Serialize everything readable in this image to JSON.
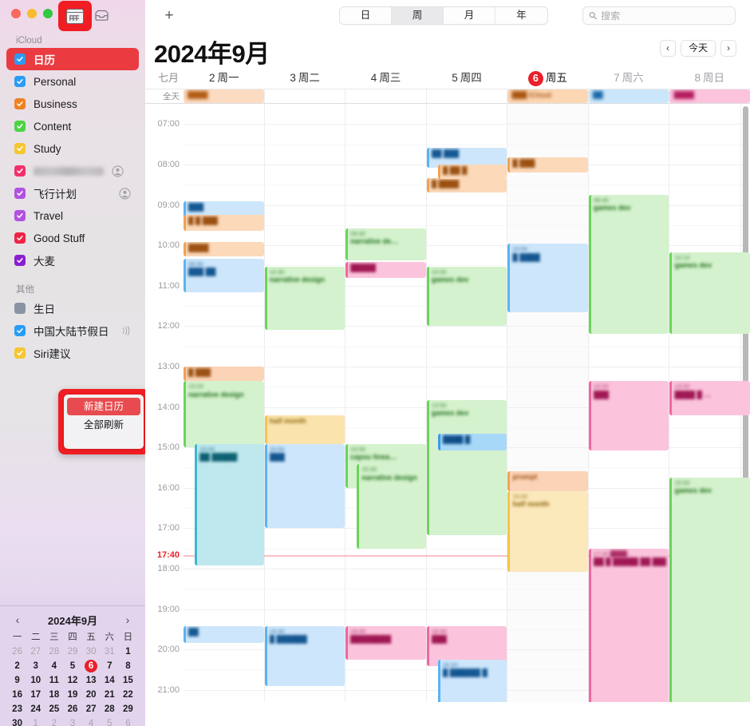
{
  "window": {
    "traffic_lights": [
      "close",
      "minimize",
      "zoom"
    ],
    "sidebar_toggle_icon": "calendar-sidebar-icon",
    "inbox_icon": "inbox-icon",
    "highlight_color": "#f01d22"
  },
  "sidebar": {
    "sections": [
      {
        "label": "iCloud",
        "items": [
          {
            "name": "日历",
            "color": "#2b9cf6",
            "checked": true,
            "selected": true,
            "redacted": false,
            "badge": ""
          },
          {
            "name": "Personal",
            "color": "#2b9cf6",
            "checked": true,
            "selected": false,
            "redacted": false,
            "badge": ""
          },
          {
            "name": "Business",
            "color": "#f08122",
            "checked": true,
            "selected": false,
            "redacted": false,
            "badge": ""
          },
          {
            "name": "Content",
            "color": "#4cd445",
            "checked": true,
            "selected": false,
            "redacted": false,
            "badge": ""
          },
          {
            "name": "Study",
            "color": "#f6c632",
            "checked": true,
            "selected": false,
            "redacted": false,
            "badge": ""
          },
          {
            "name": "",
            "color": "#f1316b",
            "checked": true,
            "selected": false,
            "redacted": true,
            "badge": "shared"
          },
          {
            "name": "飞行计划",
            "color": "#b152e0",
            "checked": true,
            "selected": false,
            "redacted": false,
            "badge": "shared"
          },
          {
            "name": "Travel",
            "color": "#b152e0",
            "checked": true,
            "selected": false,
            "redacted": false,
            "badge": ""
          },
          {
            "name": "Good Stuff",
            "color": "#f02246",
            "checked": true,
            "selected": false,
            "redacted": false,
            "badge": ""
          },
          {
            "name": "大麦",
            "color": "#8a1fd0",
            "checked": true,
            "selected": false,
            "redacted": false,
            "badge": ""
          }
        ]
      },
      {
        "label": "其他",
        "items": [
          {
            "name": "生日",
            "color": "#8a93a3",
            "checked": false,
            "selected": false,
            "redacted": false,
            "badge": ""
          },
          {
            "name": "中国大陆节假日",
            "color": "#2b9cf6",
            "checked": true,
            "selected": false,
            "redacted": false,
            "badge": "subscription"
          },
          {
            "name": "Siri建议",
            "color": "#f6c632",
            "checked": true,
            "selected": false,
            "redacted": false,
            "badge": ""
          }
        ]
      }
    ],
    "context_menu": {
      "items": [
        {
          "label": "新建日历",
          "highlighted": true
        },
        {
          "label": "全部刷新",
          "highlighted": false
        }
      ]
    },
    "mini_calendar": {
      "title": "2024年9月",
      "prev_icon": "chevron-left-icon",
      "next_icon": "chevron-right-icon",
      "weekday_labels": [
        "一",
        "二",
        "三",
        "四",
        "五",
        "六",
        "日"
      ],
      "weeks": [
        [
          {
            "d": "26",
            "out": true
          },
          {
            "d": "27",
            "out": true
          },
          {
            "d": "28",
            "out": true
          },
          {
            "d": "29",
            "out": true
          },
          {
            "d": "30",
            "out": true
          },
          {
            "d": "31",
            "out": true
          },
          {
            "d": "1",
            "out": false
          }
        ],
        [
          {
            "d": "2",
            "out": false
          },
          {
            "d": "3",
            "out": false
          },
          {
            "d": "4",
            "out": false
          },
          {
            "d": "5",
            "out": false
          },
          {
            "d": "6",
            "out": false,
            "today": true
          },
          {
            "d": "7",
            "out": false
          },
          {
            "d": "8",
            "out": false
          }
        ],
        [
          {
            "d": "9",
            "out": false
          },
          {
            "d": "10",
            "out": false
          },
          {
            "d": "11",
            "out": false
          },
          {
            "d": "12",
            "out": false
          },
          {
            "d": "13",
            "out": false
          },
          {
            "d": "14",
            "out": false
          },
          {
            "d": "15",
            "out": false
          }
        ],
        [
          {
            "d": "16",
            "out": false
          },
          {
            "d": "17",
            "out": false
          },
          {
            "d": "18",
            "out": false
          },
          {
            "d": "19",
            "out": false
          },
          {
            "d": "20",
            "out": false
          },
          {
            "d": "21",
            "out": false
          },
          {
            "d": "22",
            "out": false
          }
        ],
        [
          {
            "d": "23",
            "out": false
          },
          {
            "d": "24",
            "out": false
          },
          {
            "d": "25",
            "out": false
          },
          {
            "d": "26",
            "out": false
          },
          {
            "d": "27",
            "out": false
          },
          {
            "d": "28",
            "out": false
          },
          {
            "d": "29",
            "out": false
          }
        ],
        [
          {
            "d": "30",
            "out": false
          },
          {
            "d": "1",
            "out": true
          },
          {
            "d": "2",
            "out": true
          },
          {
            "d": "3",
            "out": true
          },
          {
            "d": "4",
            "out": true
          },
          {
            "d": "5",
            "out": true
          },
          {
            "d": "6",
            "out": true
          }
        ]
      ]
    }
  },
  "toolbar": {
    "add_label": "+",
    "views": [
      {
        "label": "日",
        "active": false
      },
      {
        "label": "周",
        "active": true
      },
      {
        "label": "月",
        "active": false
      },
      {
        "label": "年",
        "active": false
      }
    ],
    "search_placeholder": "搜索",
    "search_value": "",
    "search_icon": "search-icon"
  },
  "header": {
    "title": "2024年9月",
    "prev_icon": "chevron-left-icon",
    "next_icon": "chevron-right-icon",
    "today_label": "今天"
  },
  "week": {
    "gutter_label": "七月",
    "allday_label": "全天",
    "days": [
      {
        "num": "2",
        "weekday": "周一",
        "today": false
      },
      {
        "num": "3",
        "weekday": "周二",
        "today": false
      },
      {
        "num": "4",
        "weekday": "周三",
        "today": false
      },
      {
        "num": "5",
        "weekday": "周四",
        "today": false
      },
      {
        "num": "6",
        "weekday": "周五",
        "today": true
      },
      {
        "num": "7",
        "weekday": "周六",
        "today": false
      },
      {
        "num": "8",
        "weekday": "周日",
        "today": false
      }
    ],
    "hours": [
      "07:00",
      "08:00",
      "09:00",
      "10:00",
      "11:00",
      "12:00",
      "13:00",
      "14:00",
      "15:00",
      "16:00",
      "17:00",
      "18:00",
      "19:00",
      "20:00",
      "21:00"
    ],
    "current_time": "17:40",
    "current_time_day_index": 4
  },
  "allday_events": [
    {
      "day": 0,
      "bg": "#fbdcc2",
      "fg": "#b15a12",
      "text": "████"
    },
    {
      "day": 4,
      "bg": "#fbd7b4",
      "fg": "#a9540f",
      "text": "███ iCloud"
    },
    {
      "day": 5,
      "bg": "#cbe6fa",
      "fg": "#1766a8",
      "text": "██"
    },
    {
      "day": 6,
      "bg": "#fbc4dc",
      "fg": "#b31a5c",
      "text": "████"
    }
  ],
  "events": [
    {
      "day": 3,
      "start": "07:35",
      "end": "08:05",
      "bg": "#cde6fb",
      "bar": "#5ab4f2",
      "fg": "#12558f",
      "time": "",
      "title": "██ ███"
    },
    {
      "day": 3,
      "start": "08:00",
      "end": "08:22",
      "bg": "#fbd9b9",
      "bar": "#f0a352",
      "fg": "#9a4f10",
      "time": "",
      "title": "█ ██ █"
    },
    {
      "day": 3,
      "start": "08:20",
      "end": "08:42",
      "bg": "#fbd9b9",
      "bar": "#f0a352",
      "fg": "#9a4f10",
      "time": "",
      "title": "█ ████"
    },
    {
      "day": 0,
      "start": "08:55",
      "end": "09:18",
      "bg": "#cde6fb",
      "bar": "#5ab4f2",
      "fg": "#12558f",
      "time": "",
      "title": "███"
    },
    {
      "day": 0,
      "start": "09:15",
      "end": "09:38",
      "bg": "#fbd9b9",
      "bar": "#f0a352",
      "fg": "#9a4f10",
      "time": "",
      "title": "█ █ ███"
    },
    {
      "day": 4,
      "start": "07:50",
      "end": "08:12",
      "bg": "#fbd9b9",
      "bar": "#f0a352",
      "fg": "#9a4f10",
      "time": "",
      "title": "█ ███"
    },
    {
      "day": 0,
      "start": "09:55",
      "end": "10:17",
      "bg": "#fbd9b9",
      "bar": "#f0a352",
      "fg": "#9a4f10",
      "time": "",
      "title": "████"
    },
    {
      "day": 0,
      "start": "10:20",
      "end": "11:10",
      "bg": "#cde6fb",
      "bar": "#5ab4f2",
      "fg": "#12558f",
      "time": "09:30",
      "title": "███ ██"
    },
    {
      "day": 2,
      "start": "09:35",
      "end": "10:22",
      "bg": "#d4f2cd",
      "bar": "#6cd35c",
      "fg": "#1e6e18",
      "time": "09:30",
      "title": "narrative de…"
    },
    {
      "day": 2,
      "start": "10:25",
      "end": "10:48",
      "bg": "#fbc4dc",
      "bar": "#f2679f",
      "fg": "#9e1552",
      "time": "",
      "title": "█████"
    },
    {
      "day": 1,
      "start": "10:32",
      "end": "12:05",
      "bg": "#d4f2cd",
      "bar": "#6cd35c",
      "fg": "#1e6e18",
      "time": "10:30",
      "title": "narrative design"
    },
    {
      "day": 3,
      "start": "10:32",
      "end": "12:00",
      "bg": "#d4f2cd",
      "bar": "#6cd35c",
      "fg": "#1e6e18",
      "time": "10:30",
      "title": "games dev"
    },
    {
      "day": 4,
      "start": "09:58",
      "end": "11:40",
      "bg": "#cde6fb",
      "bar": "#5ab4f2",
      "fg": "#12558f",
      "time": "10:00",
      "title": "█ ████"
    },
    {
      "day": 5,
      "start": "08:45",
      "end": "12:12",
      "bg": "#d4f2cd",
      "bar": "#6cd35c",
      "fg": "#1e6e18",
      "time": "08:40",
      "title": "games dev"
    },
    {
      "day": 6,
      "start": "10:10",
      "end": "12:12",
      "bg": "#d4f2cd",
      "bar": "#6cd35c",
      "fg": "#1e6e18",
      "time": "10:10",
      "title": "games dev"
    },
    {
      "day": 0,
      "start": "13:00",
      "end": "13:22",
      "bg": "#fbd3b6",
      "bar": "#f0a352",
      "fg": "#9a4f10",
      "time": "",
      "title": "█ ███"
    },
    {
      "day": 0,
      "start": "13:22",
      "end": "15:00",
      "bg": "#d4f2cd",
      "bar": "#6cd35c",
      "fg": "#1e6e18",
      "time": "13:20",
      "title": "narrative design"
    },
    {
      "day": 0,
      "start": "14:55",
      "end": "17:55",
      "bg": "#bfe7ee",
      "bar": "#3fb6cc",
      "fg": "#0b5f70",
      "time": "15:00",
      "title": "██ █████"
    },
    {
      "day": 1,
      "start": "14:12",
      "end": "14:55",
      "bg": "#fbe3ad",
      "bar": "#f3c64a",
      "fg": "#8a6508",
      "time": "",
      "title": "half month"
    },
    {
      "day": 1,
      "start": "14:55",
      "end": "17:00",
      "bg": "#cde6fb",
      "bar": "#5ab4f2",
      "fg": "#12558f",
      "time": "15:00",
      "title": "███"
    },
    {
      "day": 2,
      "start": "14:55",
      "end": "16:00",
      "bg": "#d4f2cd",
      "bar": "#6cd35c",
      "fg": "#1e6e18",
      "time": "15:00",
      "title": "capsu linea…"
    },
    {
      "day": 2,
      "start": "15:25",
      "end": "17:30",
      "bg": "#d4f2cd",
      "bar": "#6cd35c",
      "fg": "#1e6e18",
      "time": "15:30",
      "title": "narrative design"
    },
    {
      "day": 3,
      "start": "13:50",
      "end": "17:10",
      "bg": "#d4f2cd",
      "bar": "#6cd35c",
      "fg": "#1e6e18",
      "time": "13:50",
      "title": "games dev"
    },
    {
      "day": 3,
      "start": "14:40",
      "end": "15:05",
      "bg": "#a8d8f7",
      "bar": "#3a9ae8",
      "fg": "#0d4d86",
      "time": "",
      "title": "████ █"
    },
    {
      "day": 5,
      "start": "13:22",
      "end": "15:05",
      "bg": "#fbc4dc",
      "bar": "#f2679f",
      "fg": "#9e1552",
      "time": "13:20",
      "title": "███"
    },
    {
      "day": 6,
      "start": "13:22",
      "end": "14:12",
      "bg": "#fbc4dc",
      "bar": "#f2679f",
      "fg": "#9e1552",
      "time": "13:20",
      "title": "████ █ …"
    },
    {
      "day": 4,
      "start": "15:35",
      "end": "16:05",
      "bg": "#fbd3b6",
      "bar": "#f0a352",
      "fg": "#9a4f10",
      "time": "",
      "title": "prompt"
    },
    {
      "day": 4,
      "start": "16:05",
      "end": "18:05",
      "bg": "#fbe8bb",
      "bar": "#f3c64a",
      "fg": "#8a6508",
      "time": "16:00",
      "title": "half month"
    },
    {
      "day": 6,
      "start": "15:45",
      "end": "21:50",
      "bg": "#d4f2cd",
      "bar": "#6cd35c",
      "fg": "#1e6e18",
      "time": "15:50",
      "title": "games dev"
    },
    {
      "day": 5,
      "start": "17:30",
      "end": "22:00",
      "bg": "#fbc4dc",
      "bar": "#f2679f",
      "fg": "#9e1552",
      "time": "17:30 ████…",
      "title": "██ █ █████ ██ ████"
    },
    {
      "day": 0,
      "start": "19:25",
      "end": "19:50",
      "bg": "#cde6fb",
      "bar": "#5ab4f2",
      "fg": "#12558f",
      "time": "",
      "title": "██"
    },
    {
      "day": 1,
      "start": "19:25",
      "end": "20:55",
      "bg": "#cde6fb",
      "bar": "#5ab4f2",
      "fg": "#12558f",
      "time": "19:30",
      "title": "█ ██████"
    },
    {
      "day": 2,
      "start": "19:25",
      "end": "20:15",
      "bg": "#fbc4dc",
      "bar": "#f2679f",
      "fg": "#9e1552",
      "time": "19:30",
      "title": "████████"
    },
    {
      "day": 3,
      "start": "19:25",
      "end": "20:25",
      "bg": "#fbc4dc",
      "bar": "#f2679f",
      "fg": "#9e1552",
      "time": "19:30",
      "title": "███"
    },
    {
      "day": 3,
      "start": "20:15",
      "end": "22:00",
      "bg": "#cde6fb",
      "bar": "#5ab4f2",
      "fg": "#12558f",
      "time": "20:20",
      "title": "█ ██████ █"
    }
  ]
}
